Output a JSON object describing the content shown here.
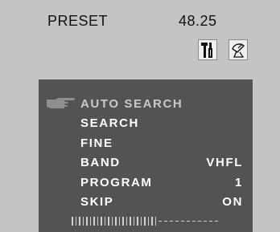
{
  "header": {
    "label": "PRESET",
    "value": "48.25"
  },
  "icons": {
    "tools": "hammer-screwdriver-icon",
    "satellite": "satellite-dish-icon",
    "pointer": "pointing-hand-icon"
  },
  "menu": {
    "items": [
      {
        "label": "AUTO SEARCH",
        "value": "",
        "selected": true
      },
      {
        "label": "SEARCH",
        "value": ""
      },
      {
        "label": "FINE",
        "value": ""
      },
      {
        "label": "BAND",
        "value": "VHFL"
      },
      {
        "label": "PROGRAM",
        "value": "1"
      },
      {
        "label": "SKIP",
        "value": "ON"
      }
    ]
  },
  "signal_meter": {
    "filled_ticks": 24,
    "empty_segments": 11
  },
  "colors": {
    "background": "#c4c4c4",
    "panel": "#535353",
    "text_dark": "#111111",
    "text_light": "#ffffff",
    "text_selected": "#c9c9c9",
    "meter": "#d0d0d0"
  }
}
